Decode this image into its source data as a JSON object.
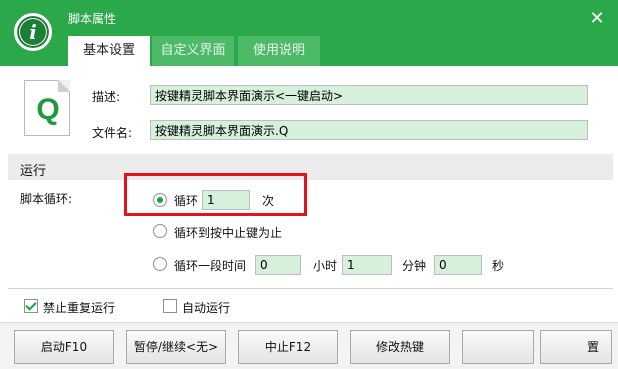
{
  "window": {
    "title": "脚本属性",
    "app_icon_glyph": "i",
    "close_glyph": "✕",
    "accent_color": "#2aa84a"
  },
  "tabs": [
    {
      "label": "基本设置",
      "active": true
    },
    {
      "label": "自定义界面",
      "active": false
    },
    {
      "label": "使用说明",
      "active": false
    }
  ],
  "script_file": {
    "icon_letter": "Q",
    "description_label": "描述:",
    "description_value": "按键精灵脚本界面演示<一键启动>",
    "filename_label": "文件名:",
    "filename_value": "按键精灵脚本界面演示.Q"
  },
  "run": {
    "section_title": "运行",
    "loop_label": "脚本循环:",
    "options": {
      "loop_count": {
        "label": "循环",
        "value": "1",
        "unit": "次",
        "checked": true
      },
      "until_stop": {
        "label": "循环到按中止键为止",
        "checked": false
      },
      "duration": {
        "label": "循环一段时间",
        "hours_value": "0",
        "hours_unit": "小时",
        "minutes_value": "1",
        "minutes_unit": "分钟",
        "seconds_value": "0",
        "seconds_unit": "秒",
        "checked": false
      }
    }
  },
  "checks": {
    "no_repeat": {
      "label": "禁止重复运行",
      "checked": true
    },
    "auto_run": {
      "label": "自动运行",
      "checked": false
    }
  },
  "buttons": {
    "start": "启动F10",
    "pause": "暂停/继续<无>",
    "stop": "中止F12",
    "hotkey": "修改热键",
    "blurred_1": "",
    "blurred_2": "置"
  },
  "highlight_color": "#e3121e"
}
